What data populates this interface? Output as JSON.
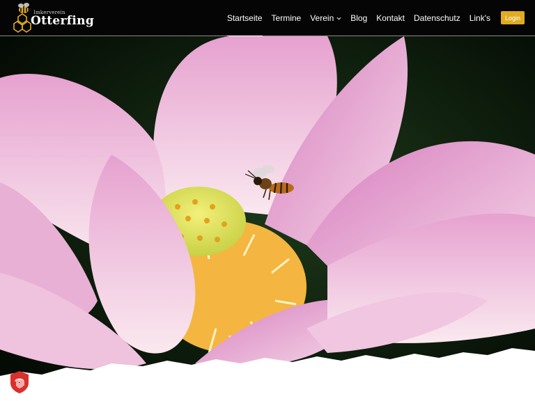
{
  "logo": {
    "small_text": "Imkerverein",
    "big_text": "Otterfing"
  },
  "nav": {
    "items": [
      {
        "label": "Startseite",
        "active": true
      },
      {
        "label": "Termine"
      },
      {
        "label": "Verein",
        "has_dropdown": true
      },
      {
        "label": "Blog"
      },
      {
        "label": "Kontakt"
      },
      {
        "label": "Datenschutz"
      },
      {
        "label": "Link's"
      }
    ],
    "login_label": "Login"
  },
  "colors": {
    "header_bg": "#050505",
    "login_bg": "#e0ac1f",
    "badge_red": "#d9302b"
  },
  "icons": {
    "logo": "bee-honeycomb-logo",
    "badge": "fingerprint-shield-icon",
    "dropdown": "chevron-down-icon"
  }
}
